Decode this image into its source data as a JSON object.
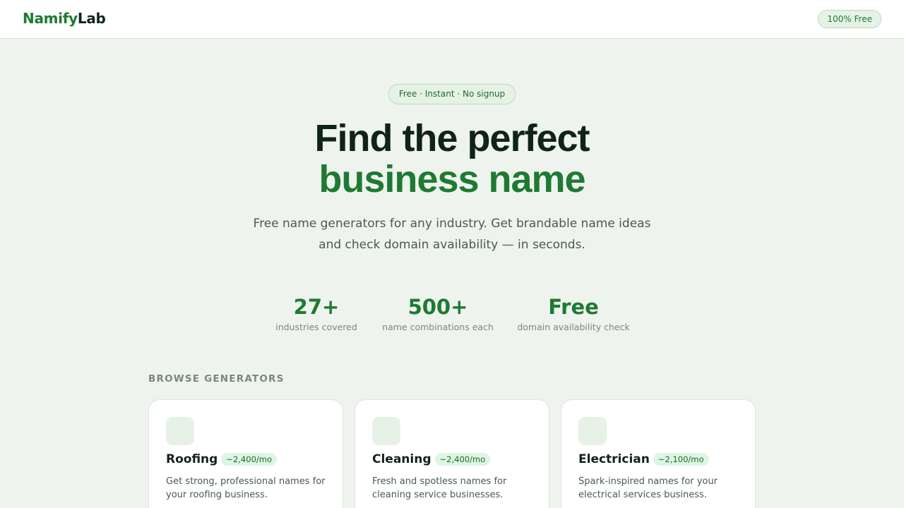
{
  "header": {
    "logo_part1": "Namify",
    "logo_part2": "Lab",
    "badge": "100% Free"
  },
  "hero": {
    "badge": "Free · Instant · No signup",
    "title_line1": "Find the perfect",
    "title_line2": "business name",
    "subtitle": "Free name generators for any industry. Get brandable name ideas and check domain availability — in seconds."
  },
  "stats": [
    {
      "value": "27+",
      "label": "industries covered"
    },
    {
      "value": "500+",
      "label": "name combinations each"
    },
    {
      "value": "Free",
      "label": "domain availability check"
    }
  ],
  "browse": {
    "section_label": "BROWSE GENERATORS",
    "cards": [
      {
        "title": "Roofing",
        "volume": "~2,400/mo",
        "description": "Get strong, professional names for your roofing business."
      },
      {
        "title": "Cleaning",
        "volume": "~2,400/mo",
        "description": "Fresh and spotless names for cleaning service businesses."
      },
      {
        "title": "Electrician",
        "volume": "~2,100/mo",
        "description": "Spark-inspired names for your electrical services business."
      }
    ]
  },
  "colors": {
    "brand_green": "#1e7a32",
    "background": "#eef3ee",
    "heading_dark": "#10231a"
  }
}
